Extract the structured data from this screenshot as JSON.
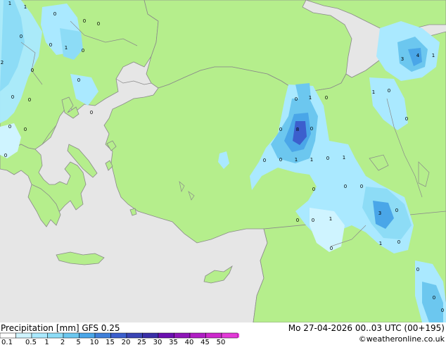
{
  "map": {
    "colors": {
      "sea": "#e6e6e6",
      "land": "#b5ee8c",
      "coast": "#8a8a8a",
      "border": "#8a8a8a",
      "precip_levels": [
        "#cff4ff",
        "#aae9ff",
        "#8ddcf6",
        "#6cc7ef",
        "#4aa6e8",
        "#3f7fd9",
        "#3c5fcd",
        "#3a45b5"
      ]
    },
    "precip_labels": [
      {
        "text": "1"
      },
      {
        "text": "1"
      },
      {
        "text": "0"
      },
      {
        "text": "0"
      },
      {
        "text": "0"
      },
      {
        "text": "0"
      },
      {
        "text": "1"
      },
      {
        "text": "0"
      },
      {
        "text": "0"
      },
      {
        "text": "2"
      },
      {
        "text": "0"
      },
      {
        "text": "0"
      },
      {
        "text": "0"
      },
      {
        "text": "0"
      },
      {
        "text": "0"
      },
      {
        "text": "0"
      },
      {
        "text": "0"
      },
      {
        "text": "0"
      },
      {
        "text": "3"
      },
      {
        "text": "4"
      },
      {
        "text": "1"
      },
      {
        "text": "1"
      },
      {
        "text": "0"
      },
      {
        "text": "0"
      },
      {
        "text": "0"
      },
      {
        "text": "1"
      },
      {
        "text": "0"
      },
      {
        "text": "0"
      },
      {
        "text": "8"
      },
      {
        "text": "0"
      },
      {
        "text": "0"
      },
      {
        "text": "0"
      },
      {
        "text": "1"
      },
      {
        "text": "1"
      },
      {
        "text": "0"
      },
      {
        "text": "1"
      },
      {
        "text": "0"
      },
      {
        "text": "0"
      },
      {
        "text": "0"
      },
      {
        "text": "3"
      },
      {
        "text": "0"
      },
      {
        "text": "0"
      },
      {
        "text": "0"
      },
      {
        "text": "1"
      },
      {
        "text": "0"
      },
      {
        "text": "1"
      },
      {
        "text": "0"
      },
      {
        "text": "0"
      },
      {
        "text": "0"
      },
      {
        "text": "0"
      }
    ]
  },
  "footer": {
    "title": "Precipitation [mm]  GFS 0.25",
    "datetime": "Mo 27-04-2026 00..03 UTC (00+195)",
    "credit": "©weatheronline.co.uk",
    "legend": {
      "labels": [
        "0.1",
        "0.5",
        "1",
        "2",
        "5",
        "10",
        "15",
        "20",
        "25",
        "30",
        "35",
        "40",
        "45",
        "50"
      ],
      "colors": [
        "#ffffff",
        "#cff4ff",
        "#aae9ff",
        "#8ddcf6",
        "#6cc7ef",
        "#4aa6e8",
        "#3f7fd9",
        "#3c5fcd",
        "#3a45b5",
        "#3a2fa8",
        "#6b0fb0",
        "#8e16b8",
        "#b01ec4",
        "#cc28cc",
        "#e33ad8"
      ]
    }
  }
}
